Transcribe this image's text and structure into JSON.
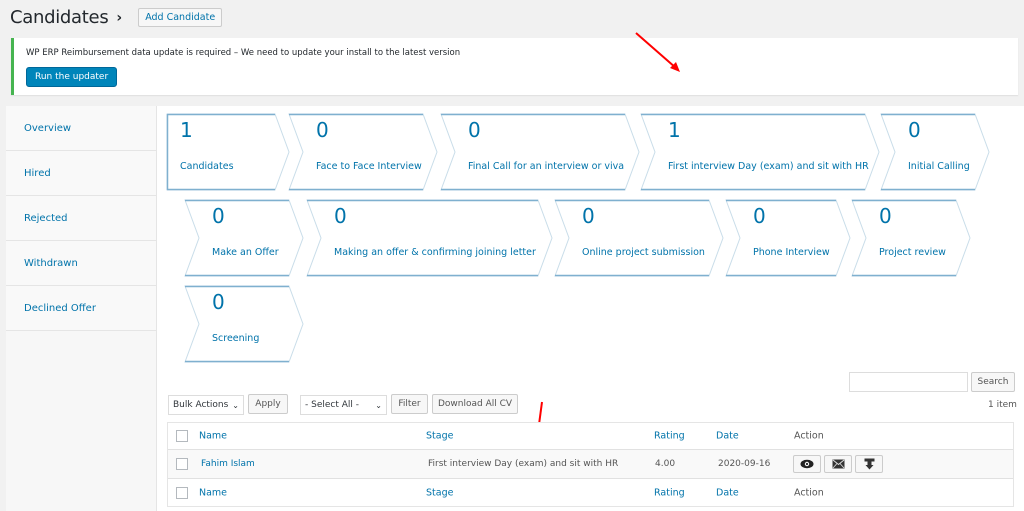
{
  "header": {
    "title": "Candidates",
    "title_chevron": "›",
    "add_button": "Add Candidate"
  },
  "notice": {
    "bold": "WP ERP Reimbursement data update is required",
    "rest": " – We need to update your install to the latest version",
    "button": "Run the updater",
    "accent_color": "#46b450"
  },
  "sidebar": {
    "items": [
      {
        "label": "Overview"
      },
      {
        "label": "Hired"
      },
      {
        "label": "Rejected"
      },
      {
        "label": "Withdrawn"
      },
      {
        "label": "Declined Offer"
      }
    ]
  },
  "stages": [
    {
      "count": "1",
      "label": "Candidates"
    },
    {
      "count": "0",
      "label": "Face to Face Interview"
    },
    {
      "count": "0",
      "label": "Final Call for an interview or viva"
    },
    {
      "count": "1",
      "label": "First interview Day (exam) and sit with HR"
    },
    {
      "count": "0",
      "label": "Initial Calling"
    },
    {
      "count": "0",
      "label": "Make an Offer"
    },
    {
      "count": "0",
      "label": "Making an offer & confirming joining letter"
    },
    {
      "count": "0",
      "label": "Online project submission"
    },
    {
      "count": "0",
      "label": "Phone Interview"
    },
    {
      "count": "0",
      "label": "Project review"
    },
    {
      "count": "0",
      "label": "Screening"
    }
  ],
  "toolbar": {
    "bulk_actions": "Bulk Actions",
    "apply": "Apply",
    "stage_filter": "- Select All -",
    "filter": "Filter",
    "download_cv": "Download All CV",
    "search_value": "",
    "search_button": "Search",
    "items_count": "1 item"
  },
  "table": {
    "columns": [
      "Name",
      "Stage",
      "Rating",
      "Date",
      "Action"
    ],
    "rows": [
      {
        "name": "Fahim Islam",
        "stage": "First interview Day (exam) and sit with HR",
        "rating": "4.00",
        "date": "2020-09-16",
        "actions": [
          "view-icon",
          "email-icon",
          "download-icon"
        ]
      }
    ]
  },
  "colors": {
    "link": "#0073aa",
    "primary_button": "#0085ba",
    "annotation_arrow": "#ff0000"
  }
}
